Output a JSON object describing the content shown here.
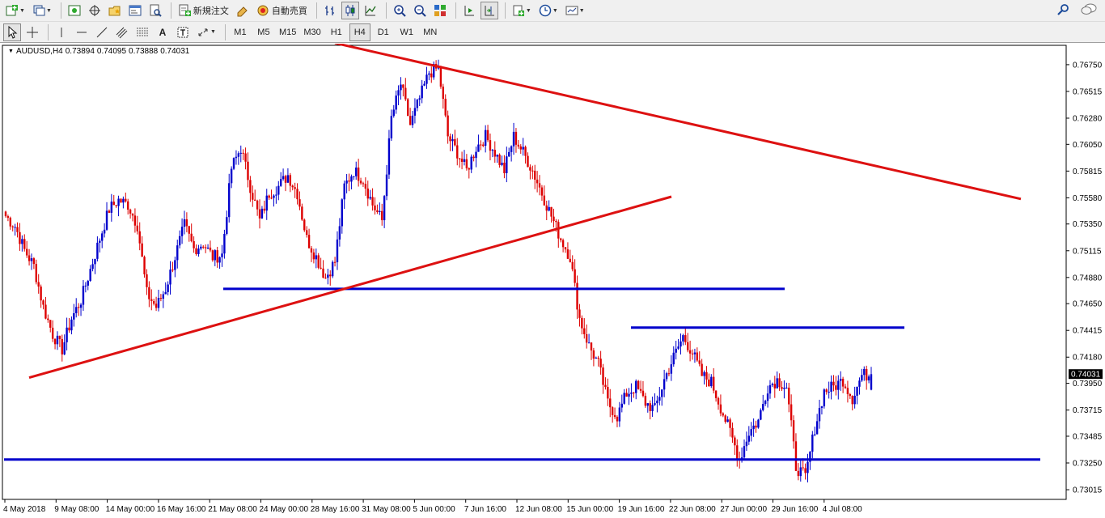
{
  "toolbar1": {
    "new_order_label": "新規注文",
    "auto_trading_label": "自動売買"
  },
  "toolbar2": {
    "text_tool_label": "A",
    "timeframes": [
      "M1",
      "M5",
      "M15",
      "M30",
      "H1",
      "H4",
      "D1",
      "W1",
      "MN"
    ],
    "active_timeframe": "H4"
  },
  "chart": {
    "symbol": "AUDUSD,H4",
    "open": "0.73894",
    "high": "0.74095",
    "low": "0.73888",
    "close": "0.74031",
    "current_price_label": "0.74031",
    "bull_color": "#0000cc",
    "bear_color": "#dd0000",
    "trendline_color": "#dd1111",
    "hline_color": "#0000cc"
  },
  "chart_data": {
    "type": "candlestick",
    "y_tick_labels": [
      "0.76750",
      "0.76515",
      "0.76280",
      "0.76050",
      "0.75815",
      "0.75580",
      "0.75350",
      "0.75115",
      "0.74880",
      "0.74650",
      "0.74415",
      "0.74180",
      "0.73950",
      "0.73715",
      "0.73485",
      "0.73250",
      "0.73015"
    ],
    "y_ticks": [
      0.7675,
      0.76515,
      0.7628,
      0.7605,
      0.75815,
      0.7558,
      0.7535,
      0.75115,
      0.7488,
      0.7465,
      0.74415,
      0.7418,
      0.7395,
      0.73715,
      0.73485,
      0.7325,
      0.73015
    ],
    "x_tick_labels": [
      "4 May 2018",
      "9 May 08:00",
      "14 May 00:00",
      "16 May 16:00",
      "21 May 08:00",
      "24 May 00:00",
      "28 May 16:00",
      "31 May 08:00",
      "5 Jun 00:00",
      "7 Jun 16:00",
      "12 Jun 08:00",
      "15 Jun 00:00",
      "19 Jun 16:00",
      "22 Jun 08:00",
      "27 Jun 00:00",
      "29 Jun 16:00",
      "4 Jul 08:00"
    ],
    "ylim": [
      0.7293,
      0.7692
    ],
    "current_price": 0.74031,
    "horizontal_lines": [
      {
        "price": 0.7478,
        "x_start": "24 May 00:00",
        "x_end": "27 Jun 00:00"
      },
      {
        "price": 0.7444,
        "x_start": "19 Jun 16:00",
        "x_end": "4 Jul 08:00"
      },
      {
        "price": 0.7328,
        "x_start": "4 May 2018",
        "x_end": "4 Jul 08:00"
      }
    ],
    "trend_lines": [
      {
        "from": {
          "date": "4 May 2018",
          "price": 0.74
        },
        "to": {
          "date": "12 Jun 08:00",
          "price": 0.7559
        }
      },
      {
        "from": {
          "date": "31 May 08:00",
          "price": 0.7694
        },
        "to": {
          "date": "4 Jul 08:00",
          "price": 0.7557
        }
      }
    ],
    "anchor_closes": [
      0.7542,
      0.7533,
      0.7512,
      0.7498,
      0.7462,
      0.7438,
      0.7425,
      0.7452,
      0.7468,
      0.7495,
      0.7522,
      0.7548,
      0.7556,
      0.7552,
      0.7534,
      0.7474,
      0.7462,
      0.7478,
      0.7506,
      0.7534,
      0.7513,
      0.7518,
      0.7506,
      0.7508,
      0.7584,
      0.7602,
      0.7568,
      0.7538,
      0.7562,
      0.7568,
      0.7578,
      0.7562,
      0.7522,
      0.7506,
      0.7488,
      0.7502,
      0.7568,
      0.7582,
      0.7574,
      0.7552,
      0.7538,
      0.7628,
      0.7658,
      0.7622,
      0.7645,
      0.7668,
      0.7672,
      0.7612,
      0.7598,
      0.7582,
      0.7602,
      0.7612,
      0.7598,
      0.7582,
      0.7612,
      0.7598,
      0.7582,
      0.7562,
      0.7542,
      0.7522,
      0.7506,
      0.7452,
      0.7428,
      0.7412,
      0.7378,
      0.7366,
      0.7386,
      0.7392,
      0.7378,
      0.7372,
      0.7398,
      0.7418,
      0.7436,
      0.7422,
      0.7402,
      0.7396,
      0.7374,
      0.7352,
      0.7328,
      0.7352,
      0.7362,
      0.7392,
      0.7398,
      0.7392,
      0.7322,
      0.7312,
      0.7356,
      0.7388,
      0.7392,
      0.7398,
      0.7382,
      0.7402,
      0.7403
    ]
  }
}
